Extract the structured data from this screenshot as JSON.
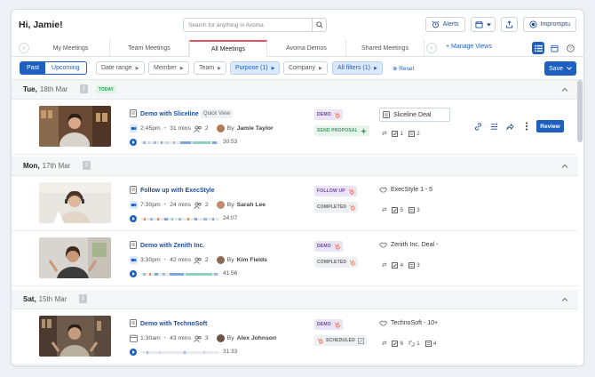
{
  "header": {
    "greeting": "Hi, Jamie!",
    "search_placeholder": "Search for anything in Avoma",
    "alerts_label": "Alerts",
    "impromptu_label": "Impromptu"
  },
  "tabs": [
    {
      "label": "My Meetings"
    },
    {
      "label": "Team Meetings"
    },
    {
      "label": "All Meetings"
    },
    {
      "label": "Avoma Demos"
    },
    {
      "label": "Shared Meetings"
    }
  ],
  "manage_views": "+ Manage Views",
  "filters": {
    "past": "Past",
    "upcoming": "Upcoming",
    "date_range": "Date range",
    "member": "Member",
    "team": "Team",
    "purpose": "Purpose (1)",
    "company": "Company",
    "all_filters": "All filters (1)",
    "reset": "Reset",
    "save": "Save"
  },
  "days": [
    {
      "day": "Tue,",
      "date": "18th Mar",
      "count": "1",
      "today": "TODAY"
    },
    {
      "day": "Mon,",
      "date": "17th Mar",
      "count": "2"
    },
    {
      "day": "Sat,",
      "date": "15th Mar",
      "count": "1"
    }
  ],
  "meetings": [
    {
      "title": "Demo with Sliceline",
      "quick_view": "Quick View",
      "time": "2:45pm",
      "duration": "31 mins",
      "attendees": "2",
      "by": "By",
      "host": "Jamie Taylor",
      "recording": "30:53",
      "purpose": "DEMO",
      "status": "SEND PROPOSAL",
      "deal": "Sliceline Deal",
      "tasks": "1",
      "notes": "2",
      "review": "Review",
      "avatar_color": "#b07a55"
    },
    {
      "title": "Follow up with ExecStyle",
      "time": "7:30pm",
      "duration": "24 mins",
      "attendees": "2",
      "by": "By",
      "host": "Sarah Lee",
      "recording": "24:07",
      "purpose": "FOLLOW UP",
      "status": "COMPLETED",
      "deal": "ExecStyle 1 - 5",
      "tasks": "5",
      "notes": "3",
      "avatar_color": "#c28a6e"
    },
    {
      "title": "Demo with Zenith Inc.",
      "time": "3:30pm",
      "duration": "42 mins",
      "attendees": "2",
      "by": "By",
      "host": "Kim Fields",
      "recording": "41:56",
      "purpose": "DEMO",
      "status": "COMPLETED",
      "deal": "Zenith Inc. Deal -",
      "tasks": "4",
      "notes": "3",
      "avatar_color": "#8d6b55"
    },
    {
      "title": "Demo with TechnoSoft",
      "time": "1:30am",
      "duration": "43 mins",
      "attendees": "3",
      "by": "By",
      "host": "Alex Johnson",
      "recording": "31:33",
      "purpose": "DEMO",
      "status": "SCHEDULED",
      "deal": "TechnoSoft - 10+",
      "tasks": "6",
      "links": "1",
      "notes": "4",
      "avatar_color": "#6d5547"
    }
  ],
  "colors": {
    "accent": "#1f5fbf",
    "active_tab": "#e05560",
    "demo_badge": "#6a44a6",
    "hubspot": "#ff7a59"
  }
}
